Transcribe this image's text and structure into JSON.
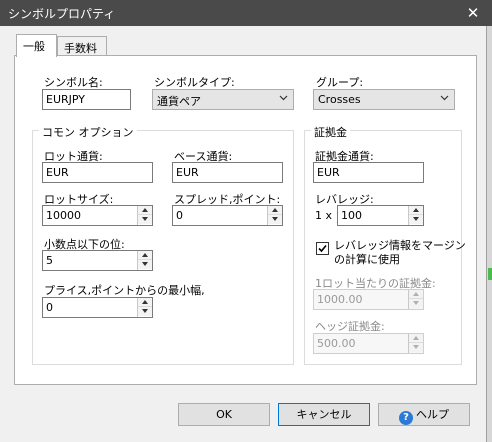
{
  "window": {
    "title": "シンボルプロパティ",
    "close_glyph": "✕"
  },
  "tabs": [
    {
      "label": "一般",
      "active": true
    },
    {
      "label": "手数料",
      "active": false
    }
  ],
  "symbol_name": {
    "label": "シンボル名:",
    "value": "EURJPY"
  },
  "symbol_type": {
    "label": "シンボルタイプ:",
    "value": "通貨ペア"
  },
  "group": {
    "label": "グループ:",
    "value": "Crosses"
  },
  "common": {
    "title": "コモン オプション",
    "lot_currency": {
      "label": "ロット通貨:",
      "value": "EUR"
    },
    "base_currency": {
      "label": "ベース通貨:",
      "value": "EUR"
    },
    "lot_size": {
      "label": "ロットサイズ:",
      "value": "10000"
    },
    "spread": {
      "label": "スプレッド,ポイント:",
      "value": "0"
    },
    "decimals": {
      "label": "小数点以下の位:",
      "value": "5"
    },
    "min_width": {
      "label": "プライス,ポイントからの最小幅,",
      "value": "0"
    }
  },
  "margin": {
    "title": "証拠金",
    "currency": {
      "label": "証拠金通貨:",
      "value": "EUR"
    },
    "leverage": {
      "label": "レバレッジ:",
      "prefix": "1 x",
      "value": "100"
    },
    "use_leverage": {
      "label_line1": "レバレッジ情報をマージン",
      "label_line2": "の計算に使用",
      "checked": true
    },
    "margin_per_lot": {
      "label": "1ロット当たりの証拠金:",
      "value": "1000.00"
    },
    "hedge_margin": {
      "label": "ヘッジ証拠金:",
      "value": "500.00"
    }
  },
  "buttons": {
    "ok": "OK",
    "cancel": "キャンセル",
    "help": "ヘルプ",
    "help_icon_glyph": "?"
  },
  "colors": {
    "titlebar": "#4a4a4a",
    "focus": "#0078d7",
    "help_icon": "#2a7bd6"
  }
}
